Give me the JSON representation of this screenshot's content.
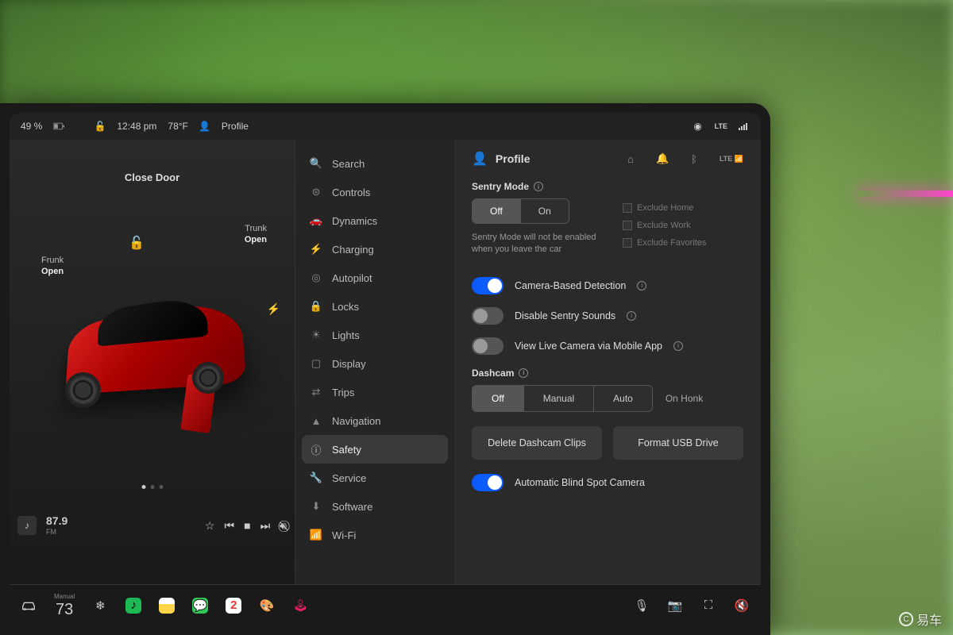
{
  "status": {
    "battery": "49 %",
    "time": "12:48 pm",
    "temp": "78°F",
    "profile": "Profile",
    "network": "LTE"
  },
  "car": {
    "close_door": "Close Door",
    "frunk_label": "Frunk",
    "frunk_state": "Open",
    "trunk_label": "Trunk",
    "trunk_state": "Open"
  },
  "player": {
    "frequency": "87.9",
    "band": "FM"
  },
  "nav": {
    "items": [
      {
        "icon": "search",
        "label": "Search"
      },
      {
        "icon": "controls",
        "label": "Controls"
      },
      {
        "icon": "dynamics",
        "label": "Dynamics"
      },
      {
        "icon": "charging",
        "label": "Charging"
      },
      {
        "icon": "autopilot",
        "label": "Autopilot"
      },
      {
        "icon": "locks",
        "label": "Locks"
      },
      {
        "icon": "lights",
        "label": "Lights"
      },
      {
        "icon": "display",
        "label": "Display"
      },
      {
        "icon": "trips",
        "label": "Trips"
      },
      {
        "icon": "navigation",
        "label": "Navigation"
      },
      {
        "icon": "safety",
        "label": "Safety"
      },
      {
        "icon": "service",
        "label": "Service"
      },
      {
        "icon": "software",
        "label": "Software"
      },
      {
        "icon": "wifi",
        "label": "Wi-Fi"
      }
    ],
    "selected_index": 10
  },
  "content": {
    "header_title": "Profile",
    "sentry": {
      "title": "Sentry Mode",
      "off": "Off",
      "on": "On",
      "selected": "Off",
      "helper": "Sentry Mode will not be enabled when you leave the car",
      "excludes": [
        "Exclude Home",
        "Exclude Work",
        "Exclude Favorites"
      ]
    },
    "toggles": [
      {
        "label": "Camera-Based Detection",
        "on": true,
        "info": true
      },
      {
        "label": "Disable Sentry Sounds",
        "on": false,
        "info": true
      },
      {
        "label": "View Live Camera via Mobile App",
        "on": false,
        "info": true
      }
    ],
    "dashcam": {
      "title": "Dashcam",
      "options": [
        "Off",
        "Manual",
        "Auto"
      ],
      "selected": "Off",
      "on_honk": "On Honk"
    },
    "buttons": {
      "delete": "Delete Dashcam Clips",
      "format": "Format USB Drive"
    },
    "blindspot": {
      "label": "Automatic Blind Spot Camera",
      "on": true
    }
  },
  "dock": {
    "climate_mode": "Manual",
    "climate_temp": "73",
    "calendar_day": "2"
  },
  "watermark": "易车"
}
